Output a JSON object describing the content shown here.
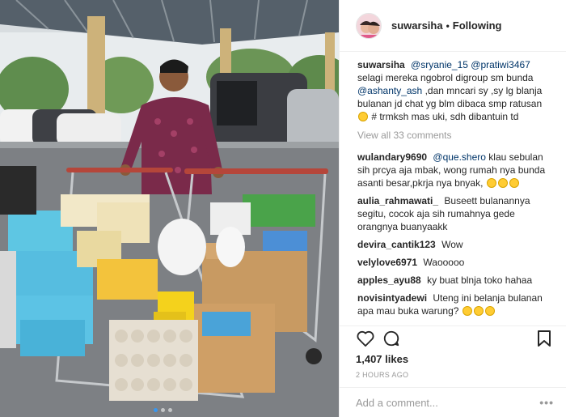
{
  "post": {
    "username": "suwarsiha",
    "follow_status": "Following",
    "separator": "•"
  },
  "caption": {
    "username": "suwarsiha",
    "mention1": "@sryanie_15",
    "mention2": "@pratiwi3467",
    "text1": "selagi mereka ngobrol digroup sm bunda",
    "mention3": "@ashanty_ash",
    "text2": ",dan mncari sy ,sy lg blanja bulanan jd chat yg blm dibaca smp ratusan",
    "text3": "# trmksh mas uki, sdh dibantuin td"
  },
  "view_all": "View all 33 comments",
  "comments": [
    {
      "username": "wulandary9690",
      "mention": "@que.shero",
      "text": "klau sebulan sih prcya aja mbak, wong rumah nya bunda asanti besar,pkrja nya bnyak,",
      "emoji_count": 3
    },
    {
      "username": "aulia_rahmawati_",
      "mention": "",
      "text": "Buseett bulanannya segitu, cocok aja sih rumahnya gede orangnya buanyaakk",
      "emoji_count": 0
    },
    {
      "username": "devira_cantik123",
      "mention": "",
      "text": "Wow",
      "emoji_count": 0
    },
    {
      "username": "velylove6971",
      "mention": "",
      "text": "Waooooo",
      "emoji_count": 0
    },
    {
      "username": "apples_ayu88",
      "mention": "",
      "text": "ky buat blnja toko hahaa",
      "emoji_count": 0
    },
    {
      "username": "novisintyadewi",
      "mention": "",
      "text": "Uteng ini belanja bulanan apa mau buka warung?",
      "emoji_count": 3
    }
  ],
  "likes": "1,407 likes",
  "timestamp": "2 HOURS AGO",
  "add_comment": {
    "placeholder": "Add a comment...",
    "more": "•••"
  },
  "icons": {
    "like": "heart-icon",
    "comment": "comment-bubble-icon",
    "save": "bookmark-icon"
  },
  "colors": {
    "mention": "#003569",
    "muted": "#999999",
    "text": "#262626",
    "emoji": "#ffcc33"
  },
  "carousel": {
    "count": 3,
    "active_index": 0
  }
}
